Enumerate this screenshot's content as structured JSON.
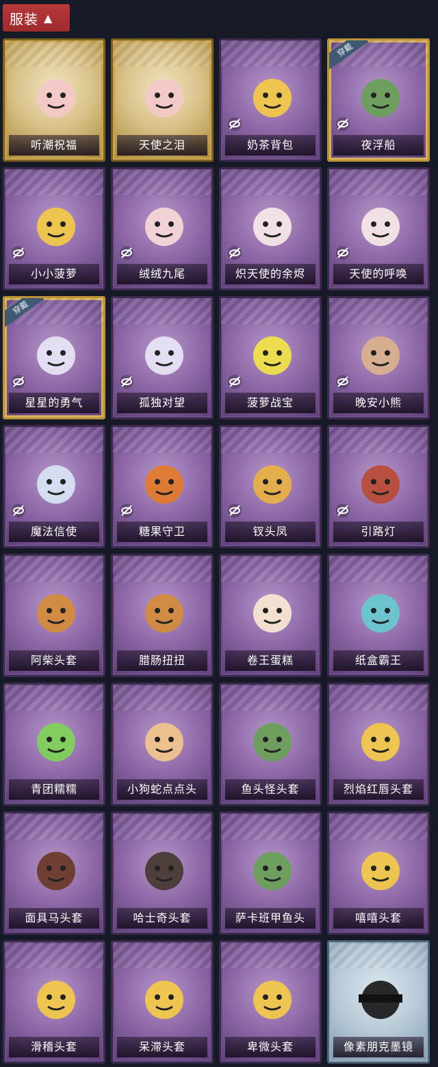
{
  "header": {
    "title": "服装",
    "expanded_icon": "chevron-up-icon"
  },
  "items": [
    {
      "name": "听潮祝福",
      "style": "gold",
      "hide": false,
      "equipped": false,
      "icon": "doll-head-icon"
    },
    {
      "name": "天使之泪",
      "style": "gold",
      "hide": false,
      "equipped": false,
      "icon": "doll-head-icon"
    },
    {
      "name": "奶茶背包",
      "style": "purple",
      "hide": true,
      "equipped": false,
      "icon": "backpack-icon"
    },
    {
      "name": "夜浮船",
      "style": "gold-frame",
      "hide": true,
      "equipped": true,
      "icon": "jellyfish-icon"
    },
    {
      "name": "小小菠萝",
      "style": "purple",
      "hide": true,
      "equipped": false,
      "icon": "pineapple-icon"
    },
    {
      "name": "绒绒九尾",
      "style": "purple",
      "hide": true,
      "equipped": false,
      "icon": "fox-icon"
    },
    {
      "name": "炽天使的余烬",
      "style": "purple",
      "hide": true,
      "equipped": false,
      "icon": "angel-icon"
    },
    {
      "name": "天使的呼唤",
      "style": "purple",
      "hide": true,
      "equipped": false,
      "icon": "angel-icon"
    },
    {
      "name": "星星的勇气",
      "style": "gold-frame",
      "hide": true,
      "equipped": true,
      "icon": "charm-icon"
    },
    {
      "name": "孤独对望",
      "style": "purple",
      "hide": true,
      "equipped": false,
      "icon": "charm-icon"
    },
    {
      "name": "菠萝战宝",
      "style": "purple",
      "hide": true,
      "equipped": false,
      "icon": "robot-icon"
    },
    {
      "name": "晚安小熊",
      "style": "purple",
      "hide": true,
      "equipped": false,
      "icon": "bear-icon"
    },
    {
      "name": "魔法信使",
      "style": "purple",
      "hide": true,
      "equipped": false,
      "icon": "elephant-icon"
    },
    {
      "name": "糖果守卫",
      "style": "purple",
      "hide": true,
      "equipped": false,
      "icon": "pumpkin-icon"
    },
    {
      "name": "钗头凤",
      "style": "purple",
      "hide": true,
      "equipped": false,
      "icon": "crown-icon"
    },
    {
      "name": "引路灯",
      "style": "purple",
      "hide": true,
      "equipped": false,
      "icon": "lantern-icon"
    },
    {
      "name": "阿柴头套",
      "style": "purple",
      "hide": false,
      "equipped": false,
      "icon": "dog-icon"
    },
    {
      "name": "腊肠扭扭",
      "style": "purple",
      "hide": false,
      "equipped": false,
      "icon": "dog-icon"
    },
    {
      "name": "卷王蛋糕",
      "style": "purple",
      "hide": false,
      "equipped": false,
      "icon": "cake-icon"
    },
    {
      "name": "纸盒霸王",
      "style": "purple",
      "hide": false,
      "equipped": false,
      "icon": "dino-icon"
    },
    {
      "name": "青团糯糯",
      "style": "purple",
      "hide": false,
      "equipped": false,
      "icon": "green-ball-icon"
    },
    {
      "name": "小狗蛇点点头",
      "style": "purple",
      "hide": false,
      "equipped": false,
      "icon": "snake-icon"
    },
    {
      "name": "鱼头怪头套",
      "style": "purple",
      "hide": false,
      "equipped": false,
      "icon": "fish-icon"
    },
    {
      "name": "烈焰红唇头套",
      "style": "purple",
      "hide": false,
      "equipped": false,
      "icon": "pikachu-icon"
    },
    {
      "name": "面具马头套",
      "style": "purple",
      "hide": false,
      "equipped": false,
      "icon": "horse-icon"
    },
    {
      "name": "哈士奇头套",
      "style": "purple",
      "hide": false,
      "equipped": false,
      "icon": "husky-icon"
    },
    {
      "name": "萨卡班甲鱼头",
      "style": "purple",
      "hide": false,
      "equipped": false,
      "icon": "fish-icon"
    },
    {
      "name": "嘻嘻头套",
      "style": "purple",
      "hide": false,
      "equipped": false,
      "icon": "grin-icon"
    },
    {
      "name": "滑稽头套",
      "style": "purple",
      "hide": false,
      "equipped": false,
      "icon": "smile-icon"
    },
    {
      "name": "呆滞头套",
      "style": "purple",
      "hide": false,
      "equipped": false,
      "icon": "stare-icon"
    },
    {
      "name": "卑微头套",
      "style": "purple",
      "hide": false,
      "equipped": false,
      "icon": "shy-icon"
    },
    {
      "name": "像素朋克墨镜",
      "style": "blue",
      "hide": false,
      "equipped": false,
      "icon": "sunglasses-icon"
    }
  ],
  "badges": {
    "equipped_label": "穿戴"
  },
  "colors": {
    "accent": "#b8383a",
    "card_purple": "#8e6aa8",
    "card_gold": "#d9c28a",
    "card_blue": "#b6c8d6"
  }
}
